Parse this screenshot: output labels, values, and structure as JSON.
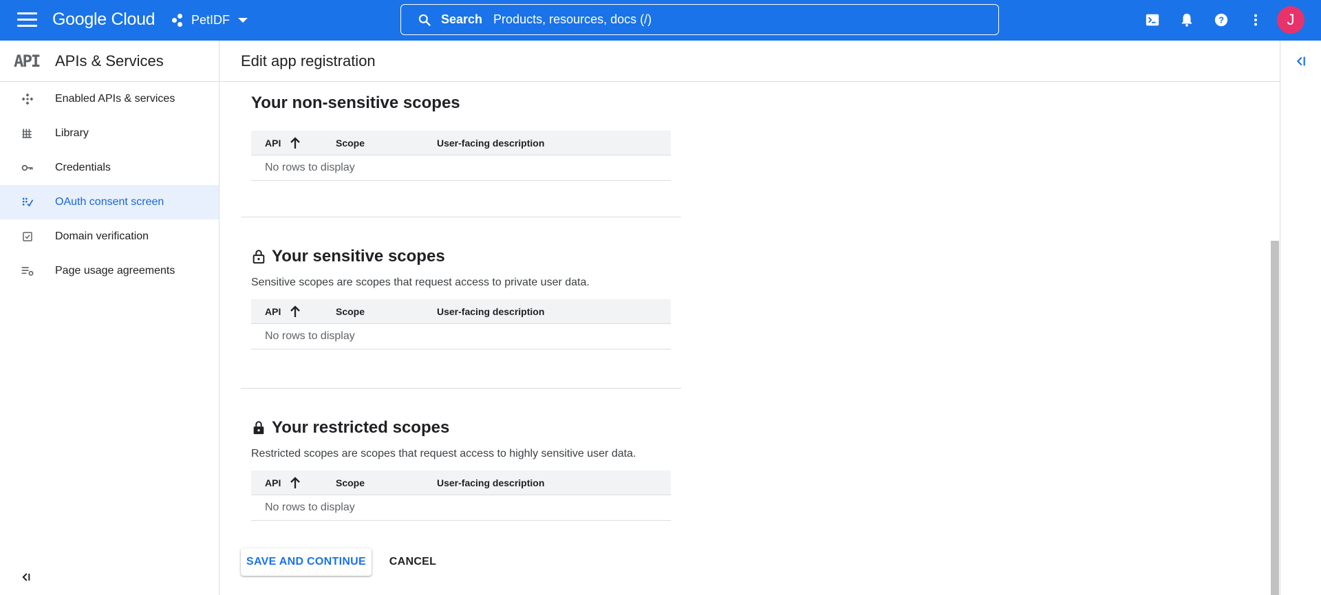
{
  "topbar": {
    "logo_text": "Google Cloud",
    "project_name": "PetIDF",
    "search_label": "Search",
    "search_placeholder": "Products, resources, docs (/)",
    "avatar_letter": "J",
    "icons": [
      "menu-icon",
      "project-icon",
      "search-icon",
      "cloud-shell-icon",
      "notifications-icon",
      "help-icon",
      "more-vert-icon"
    ]
  },
  "sidebar": {
    "logo_text": "API",
    "title": "APIs & Services",
    "items": [
      {
        "label": "Enabled APIs & services",
        "icon": "enabled-apis-icon"
      },
      {
        "label": "Library",
        "icon": "library-icon"
      },
      {
        "label": "Credentials",
        "icon": "key-icon"
      },
      {
        "label": "OAuth consent screen",
        "icon": "oauth-icon",
        "active": true
      },
      {
        "label": "Domain verification",
        "icon": "checkbox-icon"
      },
      {
        "label": "Page usage agreements",
        "icon": "settings-list-icon"
      }
    ]
  },
  "main": {
    "page_title": "Edit app registration",
    "sections": [
      {
        "title": "Your non-sensitive scopes",
        "description": "",
        "headers": [
          "API",
          "Scope",
          "User-facing description"
        ],
        "empty_text": "No rows to display"
      },
      {
        "title": "Your sensitive scopes",
        "description": "Sensitive scopes are scopes that request access to private user data.",
        "headers": [
          "API",
          "Scope",
          "User-facing description"
        ],
        "empty_text": "No rows to display"
      },
      {
        "title": "Your restricted scopes",
        "description": "Restricted scopes are scopes that request access to highly sensitive user data.",
        "headers": [
          "API",
          "Scope",
          "User-facing description"
        ],
        "empty_text": "No rows to display"
      }
    ],
    "save_label": "SAVE AND CONTINUE",
    "cancel_label": "CANCEL"
  },
  "colors": {
    "brand": "#1a73e8",
    "active_bg": "#e8f0fe",
    "avatar": "#e8336a"
  }
}
